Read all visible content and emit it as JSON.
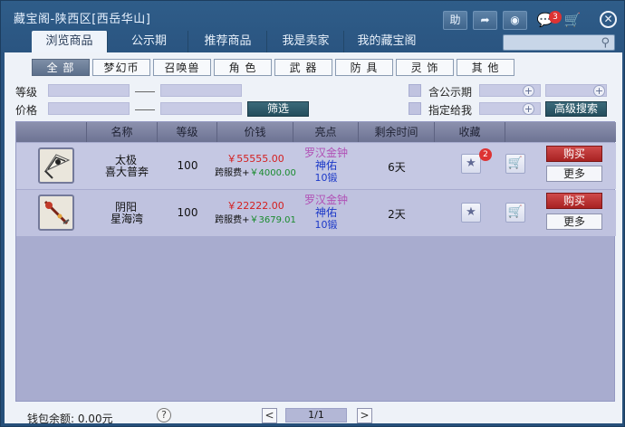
{
  "window": {
    "title": "藏宝阁-陕西区[西岳华山]"
  },
  "titlebar": {
    "help_label": "助",
    "share_icon": "share-arrow-icon",
    "record_icon": "record-icon",
    "message_badge": "3",
    "cart_icon": "cart-icon",
    "close_icon": "close-icon"
  },
  "tabs": [
    "浏览商品",
    "公示期",
    "推荐商品",
    "我是卖家",
    "我的藏宝阁"
  ],
  "search": {
    "placeholder": ""
  },
  "categories": [
    "全 部",
    "梦幻币",
    "召唤兽",
    "角 色",
    "武 器",
    "防 具",
    "灵 饰",
    "其 他"
  ],
  "filters": {
    "level_label": "等级",
    "price_label": "价格",
    "filter_button": "筛选",
    "public_period_label": "含公示期",
    "assigned_label": "指定给我",
    "advanced_button": "高级搜索"
  },
  "table": {
    "headers": [
      "名称",
      "等级",
      "价钱",
      "亮点",
      "剩余时间",
      "收藏"
    ],
    "rows": [
      {
        "name_line1": "太极",
        "name_line2": "喜大普奔",
        "level": "100",
        "price": "￥55555.00",
        "fee_label": "跨服费+",
        "fee_value": "￥4000.00",
        "highlight1": "罗汉金钟",
        "highlight2": "神佑",
        "highlight3": "10锻",
        "time_left": "6天",
        "fav_badge": "2",
        "buy_label": "购买",
        "more_label": "更多"
      },
      {
        "name_line1": "阴阳",
        "name_line2": "星海湾",
        "level": "100",
        "price": "￥22222.00",
        "fee_label": "跨服费+",
        "fee_value": "￥3679.01",
        "highlight1": "罗汉金钟",
        "highlight2": "神佑",
        "highlight3": "10锻",
        "time_left": "2天",
        "buy_label": "购买",
        "more_label": "更多"
      }
    ]
  },
  "footer": {
    "wallet": "钱包余额: 0.00元",
    "help": "?",
    "prev": "<",
    "page": "1/1",
    "next": ">"
  }
}
